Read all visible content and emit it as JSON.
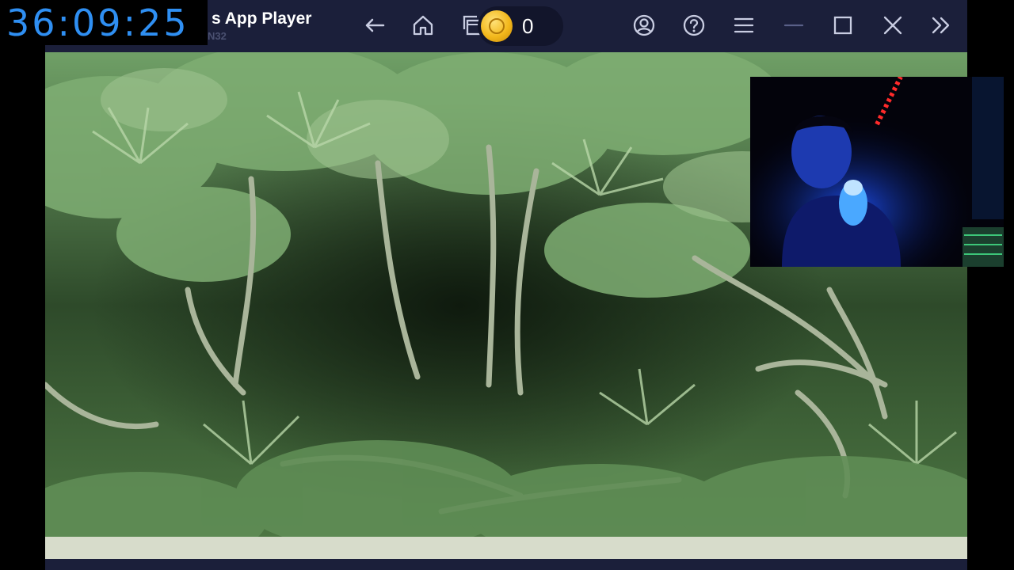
{
  "window": {
    "title": "s App Player",
    "subtitle": "N32"
  },
  "toolbar": {
    "coin_count": "0",
    "icons": [
      "back-arrow-icon",
      "home-icon",
      "recent-apps-icon",
      "coin-icon",
      "account-icon",
      "help-icon",
      "menu-icon",
      "minimize-icon",
      "maximize-icon",
      "close-icon",
      "sidebar-expand-icon"
    ]
  },
  "timer": {
    "text": "36:09:25"
  },
  "colors": {
    "chrome": "#1b1f3a",
    "timer_text": "#2f8ff2",
    "coin": "#f3b81c"
  }
}
